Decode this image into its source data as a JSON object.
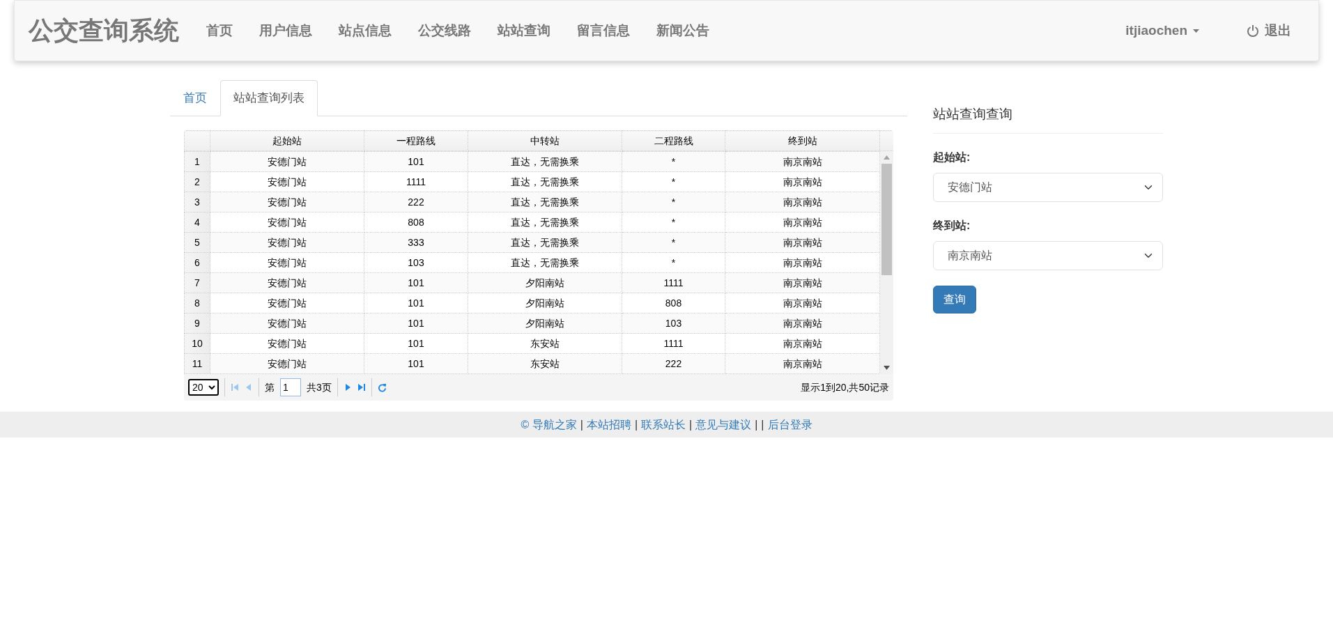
{
  "navbar": {
    "brand": "公交查询系统",
    "links": [
      {
        "label": "首页",
        "selected": false
      },
      {
        "label": "用户信息",
        "selected": false
      },
      {
        "label": "站点信息",
        "selected": false
      },
      {
        "label": "公交线路",
        "selected": false
      },
      {
        "label": "站站查询",
        "selected": false
      },
      {
        "label": "留言信息",
        "selected": false
      },
      {
        "label": "新闻公告",
        "selected": false
      }
    ],
    "user": "itjiaochen",
    "logout": "退出"
  },
  "tabs": [
    {
      "label": "首页",
      "selected": false
    },
    {
      "label": "站站查询列表",
      "selected": true
    }
  ],
  "table": {
    "columns": [
      "起始站",
      "一程路线",
      "中转站",
      "二程路线",
      "终到站"
    ],
    "rows": [
      {
        "index": "1",
        "cells": [
          "安德门站",
          "101",
          "直达，无需换乘",
          "*",
          "南京南站"
        ]
      },
      {
        "index": "2",
        "cells": [
          "安德门站",
          "1111",
          "直达，无需换乘",
          "*",
          "南京南站"
        ]
      },
      {
        "index": "3",
        "cells": [
          "安德门站",
          "222",
          "直达，无需换乘",
          "*",
          "南京南站"
        ]
      },
      {
        "index": "4",
        "cells": [
          "安德门站",
          "808",
          "直达，无需换乘",
          "*",
          "南京南站"
        ]
      },
      {
        "index": "5",
        "cells": [
          "安德门站",
          "333",
          "直达，无需换乘",
          "*",
          "南京南站"
        ]
      },
      {
        "index": "6",
        "cells": [
          "安德门站",
          "103",
          "直达，无需换乘",
          "*",
          "南京南站"
        ]
      },
      {
        "index": "7",
        "cells": [
          "安德门站",
          "101",
          "夕阳南站",
          "1111",
          "南京南站"
        ]
      },
      {
        "index": "8",
        "cells": [
          "安德门站",
          "101",
          "夕阳南站",
          "808",
          "南京南站"
        ]
      },
      {
        "index": "9",
        "cells": [
          "安德门站",
          "101",
          "夕阳南站",
          "103",
          "南京南站"
        ]
      },
      {
        "index": "10",
        "cells": [
          "安德门站",
          "101",
          "东安站",
          "1111",
          "南京南站"
        ]
      },
      {
        "index": "11",
        "cells": [
          "安德门站",
          "101",
          "东安站",
          "222",
          "南京南站"
        ]
      }
    ]
  },
  "pager": {
    "page_size": "20",
    "page_label": "第",
    "page": "1",
    "total_pages": "共3页",
    "summary": "显示1到20,共50记录"
  },
  "query_panel": {
    "title": "站站查询查询",
    "fields": [
      {
        "label": "起始站:",
        "value": "安德门站"
      },
      {
        "label": "终到站:",
        "value": "南京南站"
      }
    ],
    "button": "查询"
  },
  "footer": [
    {
      "kind": "link",
      "text": "© 导航之家"
    },
    {
      "kind": "separator",
      "text": "|"
    },
    {
      "kind": "link",
      "text": "本站招聘"
    },
    {
      "kind": "separator",
      "text": "|"
    },
    {
      "kind": "link",
      "text": "联系站长"
    },
    {
      "kind": "separator",
      "text": "|"
    },
    {
      "kind": "link",
      "text": "意见与建议"
    },
    {
      "kind": "separator",
      "text": "|"
    },
    {
      "kind": "separator",
      "text": "|"
    },
    {
      "kind": "link",
      "text": "后台登录"
    }
  ]
}
